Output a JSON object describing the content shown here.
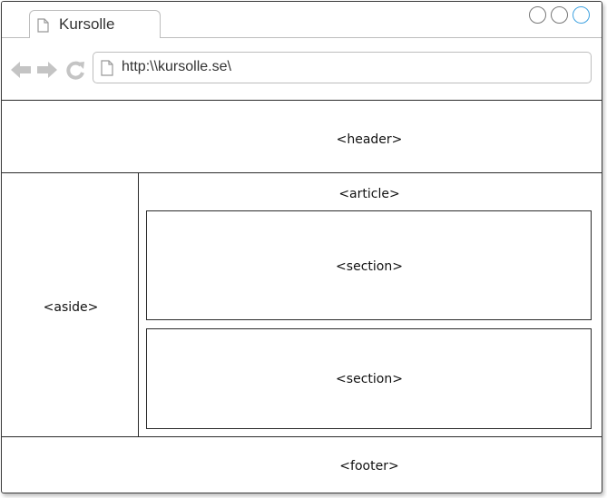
{
  "browser": {
    "tab_title": "Kursolle",
    "url": "http:\\\\kursolle.se\\"
  },
  "wireframe": {
    "header": "<header>",
    "aside": "<aside>",
    "article": "<article>",
    "sections": [
      "<section>",
      "<section>"
    ],
    "footer": "<footer>"
  },
  "colors": {
    "frame": "#2a2a2a",
    "chrome_border": "#bdbdbd",
    "active_window_button": "#3fa2e0",
    "nav_icon": "#c4c4c4"
  },
  "icons": [
    "document-icon",
    "back-arrow-icon",
    "forward-arrow-icon",
    "reload-icon"
  ]
}
